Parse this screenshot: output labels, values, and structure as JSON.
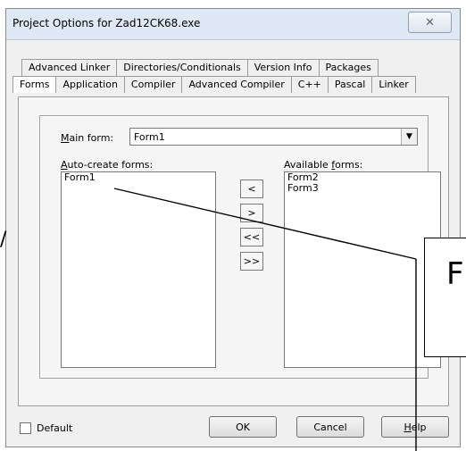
{
  "window": {
    "title": "Project Options for Zad12CK68.exe",
    "close_glyph": "✕"
  },
  "tabs": {
    "row1": [
      "Advanced Linker",
      "Directories/Conditionals",
      "Version Info",
      "Packages"
    ],
    "row2": [
      "Forms",
      "Application",
      "Compiler",
      "Advanced Compiler",
      "C++",
      "Pascal",
      "Linker"
    ],
    "active": "Forms"
  },
  "forms_page": {
    "main_form_label_key": "M",
    "main_form_label_rest": "ain form:",
    "main_form_value": "Form1",
    "auto_create_label_key": "A",
    "auto_create_label_rest": "uto-create forms:",
    "available_label_pre": "Available ",
    "available_label_key": "f",
    "available_label_rest": "orms:",
    "auto_create_items": [
      "Form1"
    ],
    "available_items": [
      "Form2",
      "Form3"
    ],
    "move_buttons": [
      "<",
      ">",
      "<<",
      ">>"
    ]
  },
  "footer": {
    "default_label": "Default",
    "ok_label": "OK",
    "cancel_label": "Cancel",
    "help_key": "H",
    "help_rest": "elp"
  },
  "annotation": {
    "text": "F",
    "stroke_text": "/"
  },
  "colors": {
    "titlebar": "#dfe9f5",
    "dialog_bg": "#f0f0f0",
    "list_bg": "#ffffff"
  }
}
